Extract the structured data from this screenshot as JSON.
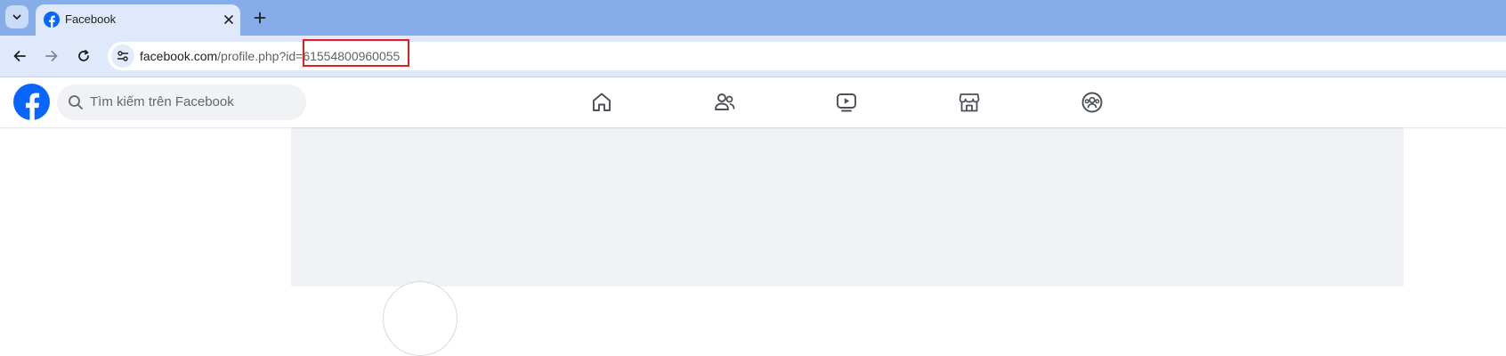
{
  "browser": {
    "tab": {
      "title": "Facebook",
      "favicon": "facebook-icon"
    },
    "tab_list_icon": "chevron-down-icon",
    "new_tab_icon": "plus-icon",
    "toolbar": {
      "back_icon": "arrow-left-icon",
      "forward_icon": "arrow-right-icon",
      "reload_icon": "reload-icon",
      "site_info_icon": "tune-icon"
    },
    "address": {
      "host": "facebook.com",
      "path": "/profile.php?id=",
      "id": "61554800960055"
    }
  },
  "facebook": {
    "search_placeholder": "Tìm kiếm trên Facebook",
    "nav": [
      "home-icon",
      "friends-icon",
      "video-icon",
      "marketplace-icon",
      "groups-icon"
    ]
  },
  "colors": {
    "tabstrip": "#87ade9",
    "toolbar": "#dfe9fb",
    "facebook_blue": "#0866ff",
    "highlight": "#e02020",
    "content_bg": "#f0f2f5"
  }
}
